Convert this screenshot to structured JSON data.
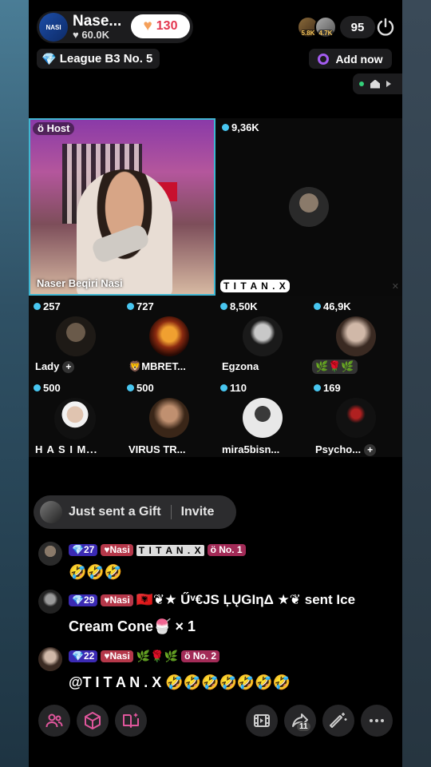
{
  "header": {
    "host_name": "Nase...",
    "host_avatar_text": "NASI",
    "host_likes": "60.0K",
    "gift_count": "130",
    "viewer_badges": [
      "5.8K",
      "4.7K"
    ],
    "viewer_count": "95",
    "league": "League B3 No. 5",
    "add_now": "Add now"
  },
  "host_seat": {
    "tag": "Host",
    "caption": "Naser Beqiri Nasi"
  },
  "seats": [
    {
      "score": "9,36K",
      "name": "T I T A N . X"
    },
    {
      "score": "257",
      "name": "Lady"
    },
    {
      "score": "727",
      "name": "MBRET..."
    },
    {
      "score": "8,50K",
      "name": "Egzona"
    },
    {
      "score": "46,9K",
      "name": "🌿🌹🌿"
    },
    {
      "score": "500",
      "name": "H A S I M..."
    },
    {
      "score": "500",
      "name": "VIRUS TR..."
    },
    {
      "score": "110",
      "name": "mira5bisn..."
    },
    {
      "score": "169",
      "name": "Psycho..."
    }
  ],
  "invite_bar": {
    "gift_text": "Just sent a Gift",
    "invite_text": "Invite"
  },
  "chat": [
    {
      "level": "27",
      "fan": "Nasi",
      "user": "T I T A N . X",
      "rank": "No. 1",
      "line1": "🤣🤣🤣",
      "line2": ""
    },
    {
      "level": "29",
      "fan": "Nasi",
      "user": "🇦🇱❦★ Űᵛ€JS ĻŲGIηΔ ★❦ sent Ice",
      "rank": "",
      "line1": "Cream Cone🍧 × 1",
      "line2": ""
    },
    {
      "level": "22",
      "fan": "Nasi",
      "user": "🌿🌹🌿",
      "rank": "No. 2",
      "line1": "@T I T A N . X 🤣🤣🤣🤣🤣🤣🤣",
      "line2": ""
    }
  ],
  "bottom_bar": {
    "share_count": "11",
    "buttons": [
      "people-icon",
      "cube-icon",
      "book-sparkle-icon",
      "film-icon",
      "share-icon",
      "magic-wand-icon",
      "more-icon"
    ]
  },
  "colors": {
    "accent_cyan": "#48c6f0",
    "host_border": "#3fb7d2",
    "level_badge": "#3b2ab3",
    "fan_badge": "#b5384a"
  }
}
